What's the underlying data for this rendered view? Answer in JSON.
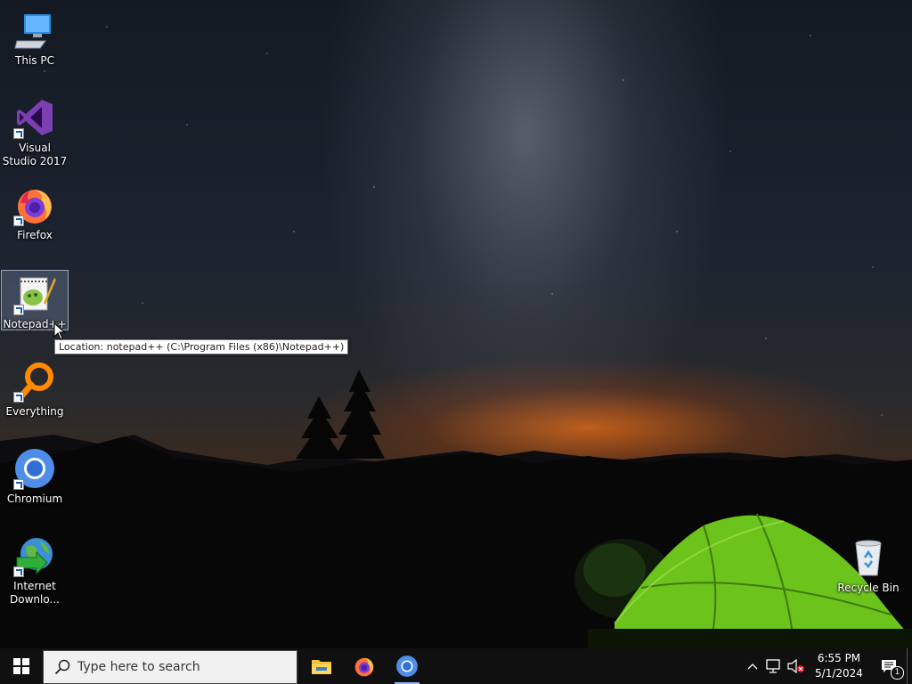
{
  "desktop": {
    "icons": [
      {
        "label": "This PC",
        "icon": "this-pc-icon"
      },
      {
        "label": "Visual Studio 2017",
        "icon": "visual-studio-icon"
      },
      {
        "label": "Firefox",
        "icon": "firefox-icon"
      },
      {
        "label": "Notepad++",
        "icon": "notepad-plus-plus-icon",
        "selected": true
      },
      {
        "label": "Everything",
        "icon": "everything-search-icon"
      },
      {
        "label": "Chromium",
        "icon": "chromium-icon"
      },
      {
        "label": "Internet Downlo...",
        "icon": "internet-download-manager-icon"
      },
      {
        "label": "Recycle Bin",
        "icon": "recycle-bin-icon"
      }
    ],
    "tooltip": "Location: notepad++ (C:\\Program Files (x86)\\Notepad++)"
  },
  "taskbar": {
    "search_placeholder": "Type here to search",
    "pinned_apps": [
      {
        "name": "File Explorer",
        "icon": "file-explorer-icon"
      },
      {
        "name": "Firefox",
        "icon": "firefox-icon"
      },
      {
        "name": "Chromium",
        "icon": "chromium-icon",
        "running": true
      }
    ],
    "clock": {
      "time": "6:55 PM",
      "date": "5/1/2024"
    },
    "notifications_count": "1",
    "tray_icons": [
      "chevron-up-icon",
      "network-icon",
      "volume-muted-icon",
      "action-center-icon"
    ]
  },
  "colors": {
    "taskbar": "#101010",
    "accent": "#1e90ff",
    "tent": "#6cc31b",
    "sunset": "#e8661a"
  }
}
